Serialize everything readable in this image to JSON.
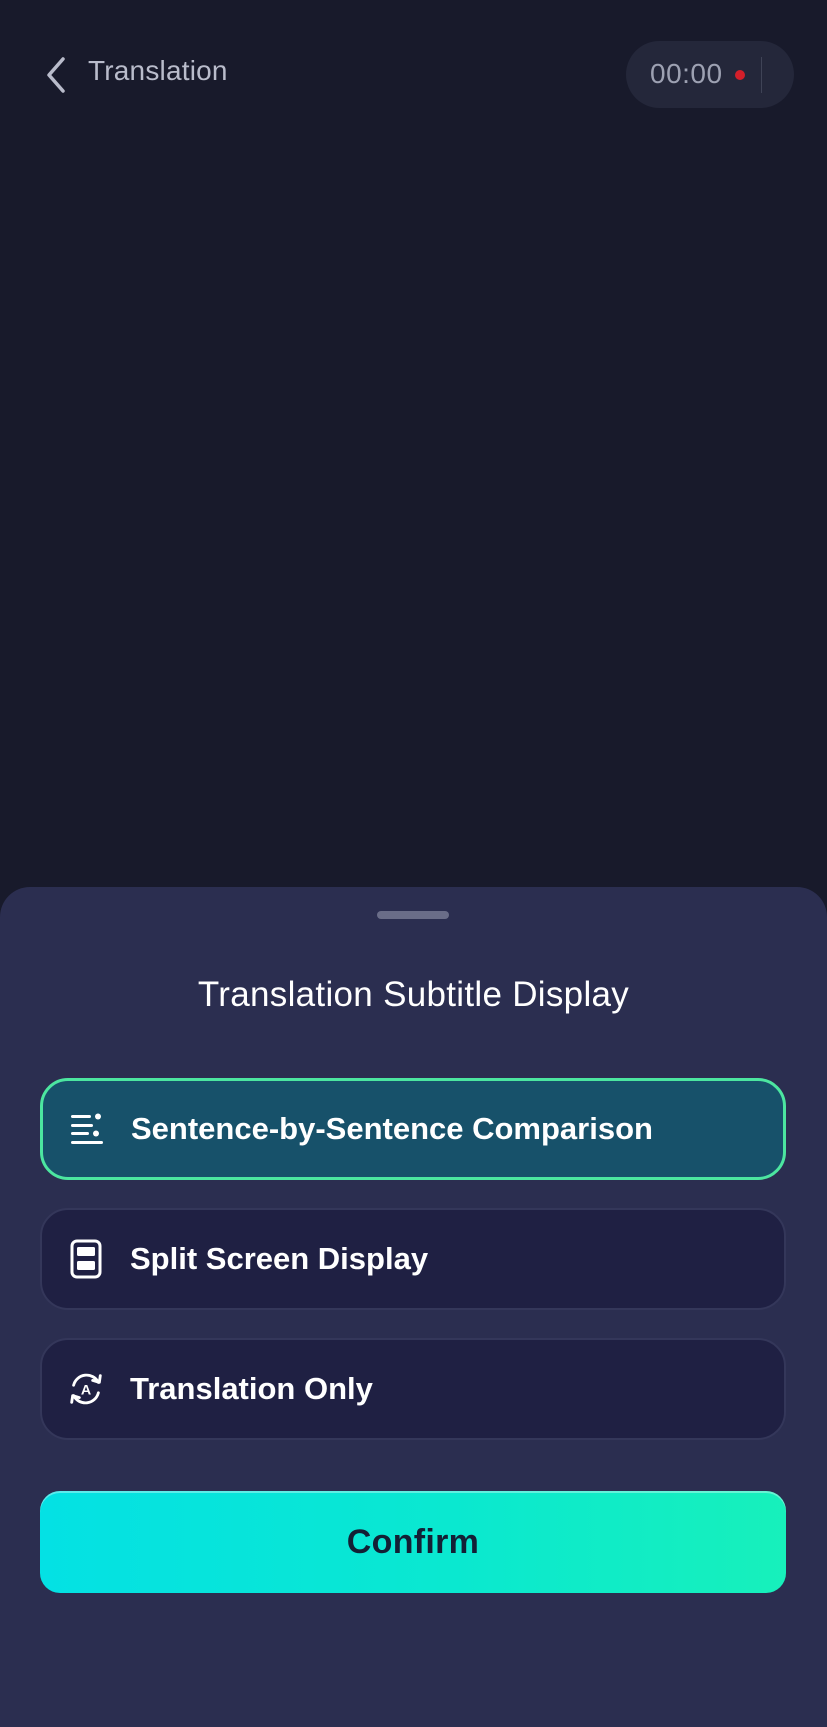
{
  "header": {
    "title": "Translation",
    "timer": "00:00",
    "back_icon": "chevron-left-icon",
    "recording_color": "#d31f2a"
  },
  "sheet": {
    "title": "Translation Subtitle Display",
    "options": [
      {
        "label": "Sentence-by-Sentence Comparison",
        "icon": "list-lines-icon",
        "selected": true
      },
      {
        "label": "Split Screen Display",
        "icon": "split-screen-icon",
        "selected": false
      },
      {
        "label": "Translation Only",
        "icon": "translate-cycle-icon",
        "selected": false
      }
    ],
    "confirm_label": "Confirm",
    "colors": {
      "accent": "#4ce6a0",
      "selected_bg": "#17516a",
      "confirm_start": "#04e1e4",
      "confirm_end": "#17f0bb"
    }
  }
}
